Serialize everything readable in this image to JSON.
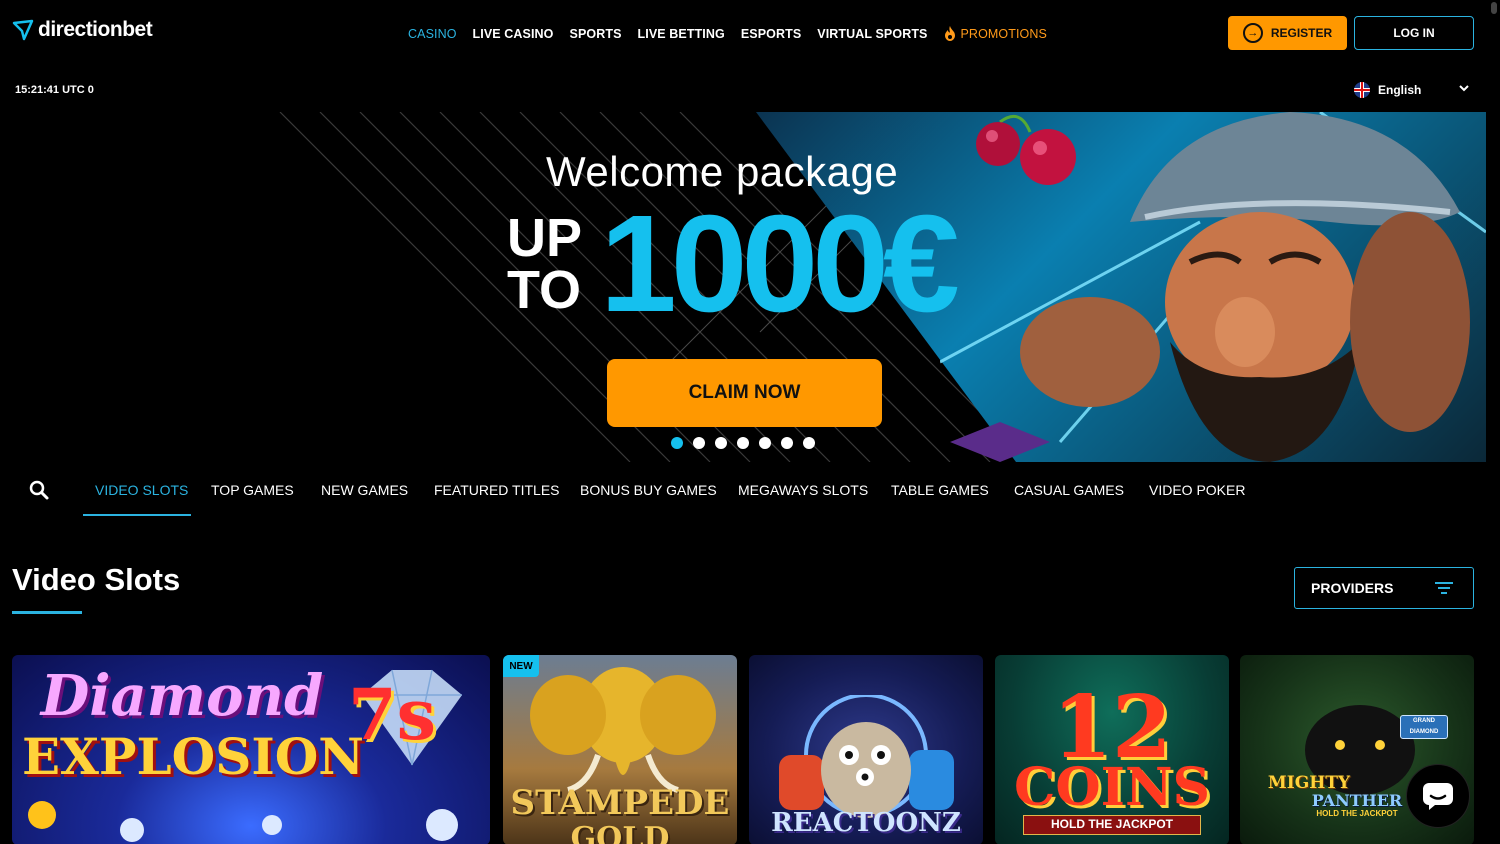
{
  "brand": {
    "name_part1": "direction",
    "name_part2": "bet"
  },
  "nav": {
    "items": [
      {
        "label": "CASINO",
        "active": true
      },
      {
        "label": "LIVE CASINO"
      },
      {
        "label": "SPORTS"
      },
      {
        "label": "LIVE BETTING"
      },
      {
        "label": "ESPORTS"
      },
      {
        "label": "VIRTUAL SPORTS"
      },
      {
        "label": "PROMOTIONS",
        "icon": "fire-icon"
      }
    ]
  },
  "auth": {
    "register_label": "REGISTER",
    "login_label": "LOG IN"
  },
  "clock": "15:21:41 UTC 0",
  "language": {
    "selected": "English"
  },
  "banner": {
    "headline": "Welcome package",
    "prefix_line1": "UP",
    "prefix_line2": "TO",
    "amount": "1000€",
    "cta_label": "CLAIM NOW",
    "slide_count": 7,
    "active_slide": 1
  },
  "categories": [
    "VIDEO SLOTS",
    "TOP GAMES",
    "NEW GAMES",
    "FEATURED TITLES",
    "BONUS BUY GAMES",
    "MEGAWAYS SLOTS",
    "TABLE GAMES",
    "CASUAL GAMES",
    "VIDEO POKER"
  ],
  "section": {
    "title": "Video Slots",
    "providers_label": "PROVIDERS"
  },
  "games": [
    {
      "title_line1": "Diamond",
      "title_line2": "EXPLOSION",
      "title_badge": "7s"
    },
    {
      "title_line1": "STAMPEDE",
      "title_line2": "GOLD",
      "badge": "NEW"
    },
    {
      "title_line1": "REACTOONZ"
    },
    {
      "title_line1": "12",
      "title_line2": "COINS",
      "subtitle": "HOLD THE JACKPOT"
    },
    {
      "title_line1": "MIGHTY",
      "title_line2": "PANTHER",
      "subtitle": "HOLD THE JACKPOT",
      "corner": "GRAND DIAMOND"
    }
  ],
  "colors": {
    "accent": "#2bb3e0",
    "brand_orange": "#ff9800",
    "amount_blue": "#15c0ee"
  }
}
